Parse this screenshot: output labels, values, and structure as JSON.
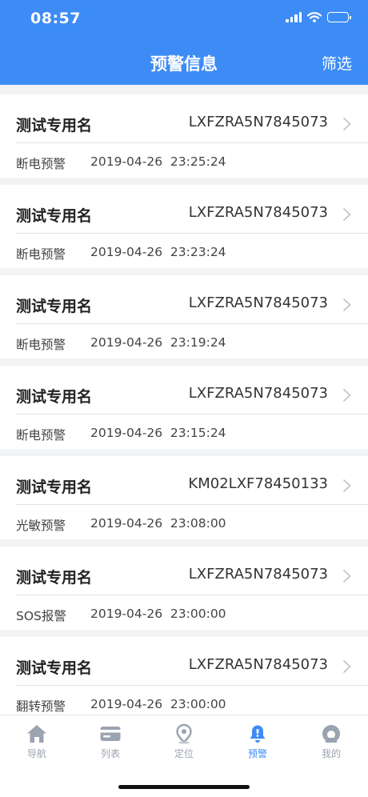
{
  "status_bar": {
    "time": "08:57"
  },
  "header": {
    "title": "预警信息",
    "filter_label": "筛选"
  },
  "colors": {
    "brand": "#3d8cf6",
    "inactive": "#9aa3b0"
  },
  "alerts": [
    {
      "name": "测试专用名",
      "code": "LXFZRA5N7845073",
      "type": "断电预警",
      "time": "2019-04-26  23:25:24"
    },
    {
      "name": "测试专用名",
      "code": "LXFZRA5N7845073",
      "type": "断电预警",
      "time": "2019-04-26  23:23:24"
    },
    {
      "name": "测试专用名",
      "code": "LXFZRA5N7845073",
      "type": "断电预警",
      "time": "2019-04-26  23:19:24"
    },
    {
      "name": "测试专用名",
      "code": "LXFZRA5N7845073",
      "type": "断电预警",
      "time": "2019-04-26  23:15:24"
    },
    {
      "name": "测试专用名",
      "code": "KM02LXF78450133",
      "type": "光敏预警",
      "time": "2019-04-26  23:08:00"
    },
    {
      "name": "测试专用名",
      "code": "LXFZRA5N7845073",
      "type": "SOS报警",
      "time": "2019-04-26  23:00:00"
    },
    {
      "name": "测试专用名",
      "code": "LXFZRA5N7845073",
      "type": "翻转预警",
      "time": "2019-04-26  23:00:00"
    }
  ],
  "tabbar": {
    "items": [
      {
        "label": "导航",
        "icon": "home-icon"
      },
      {
        "label": "列表",
        "icon": "card-icon"
      },
      {
        "label": "定位",
        "icon": "location-pin-icon"
      },
      {
        "label": "预警",
        "icon": "bell-icon",
        "active": true
      },
      {
        "label": "我的",
        "icon": "user-icon"
      }
    ]
  }
}
